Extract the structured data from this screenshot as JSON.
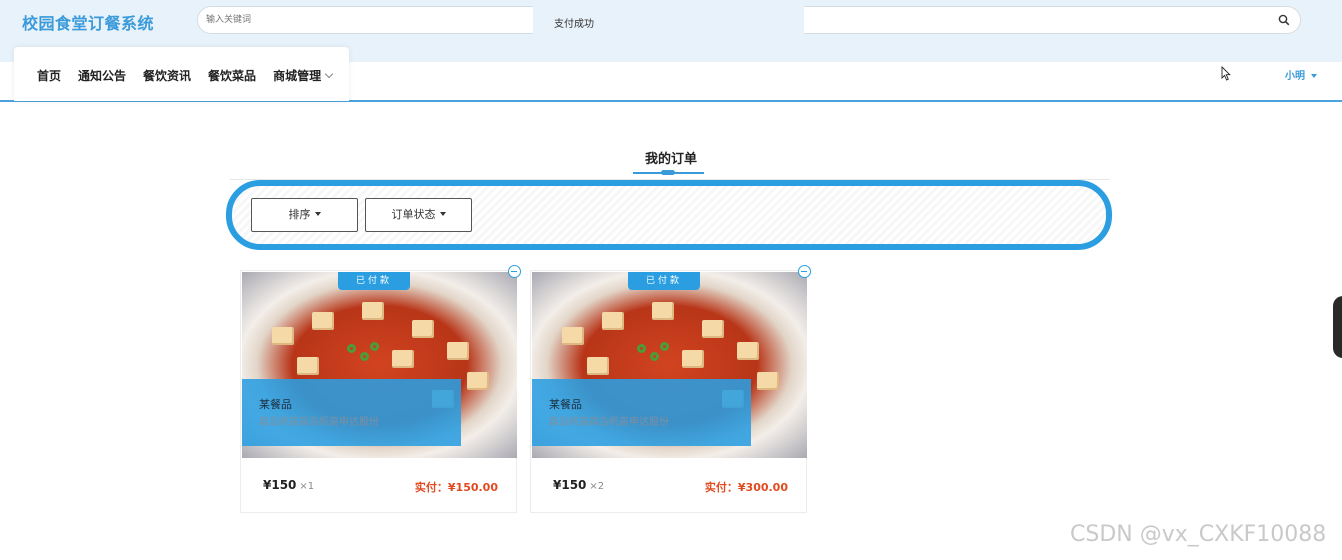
{
  "header": {
    "brand": "校园食堂订餐系统",
    "search_placeholder": "输入关键词",
    "pay_status": "支付成功"
  },
  "nav": {
    "items": [
      {
        "label": "首页"
      },
      {
        "label": "通知公告"
      },
      {
        "label": "餐饮资讯"
      },
      {
        "label": "餐饮菜品"
      },
      {
        "label": "商城管理"
      }
    ],
    "user": "小明"
  },
  "page": {
    "title": "我的订单"
  },
  "filters": {
    "sort_label": "排序",
    "status_label": "订单状态"
  },
  "orders": [
    {
      "status": "已付款",
      "name": "某餐品",
      "desc": "森岛帆高森岛帆高申达股份",
      "price": "¥150",
      "qty": "×1",
      "paid": "实付：¥150.00"
    },
    {
      "status": "已付款",
      "name": "某餐品",
      "desc": "森岛帆高森岛帆高申达股份",
      "price": "¥150",
      "qty": "×2",
      "paid": "实付：¥300.00"
    }
  ],
  "watermark": "CSDN @vx_CXKF10088",
  "colors": {
    "accent": "#2a9ee1",
    "brand": "#3b9ad9",
    "paid": "#e04a1f",
    "header_bg": "#e8f2fb"
  }
}
